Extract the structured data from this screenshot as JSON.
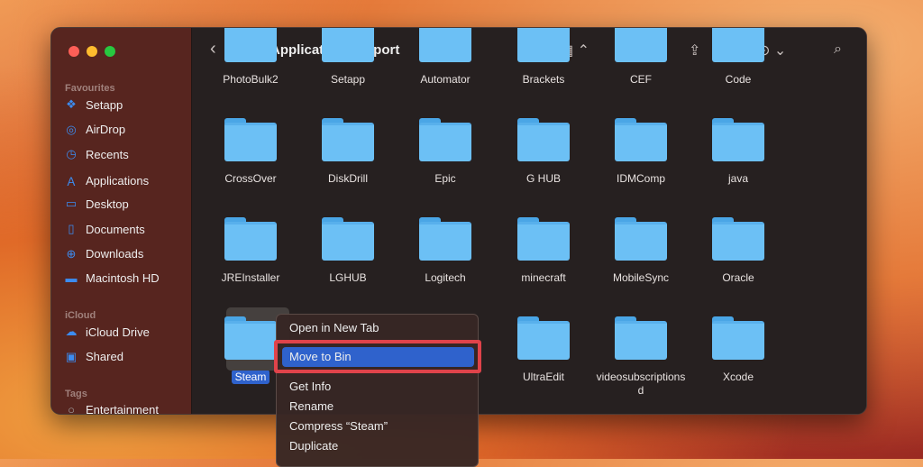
{
  "window": {
    "title": "Application Support"
  },
  "sidebar": {
    "sections": [
      {
        "title": "Favourites",
        "items": [
          {
            "label": "Setapp",
            "icon": "setapp-icon"
          },
          {
            "label": "AirDrop",
            "icon": "airdrop-icon"
          },
          {
            "label": "Recents",
            "icon": "clock-icon"
          },
          {
            "label": "Applications",
            "icon": "applications-icon"
          },
          {
            "label": "Desktop",
            "icon": "desktop-icon"
          },
          {
            "label": "Documents",
            "icon": "document-icon"
          },
          {
            "label": "Downloads",
            "icon": "download-icon"
          },
          {
            "label": "Macintosh HD",
            "icon": "disk-icon"
          }
        ]
      },
      {
        "title": "iCloud",
        "items": [
          {
            "label": "iCloud Drive",
            "icon": "cloud-icon"
          },
          {
            "label": "Shared",
            "icon": "shared-folder-icon"
          }
        ]
      },
      {
        "title": "Tags",
        "items": [
          {
            "label": "Entertainment",
            "icon": "tag-circle-icon"
          }
        ]
      }
    ]
  },
  "grid": {
    "row0": [
      "PhotoBulk2",
      "Setapp",
      "Automator",
      "Brackets",
      "CEF",
      "Code"
    ],
    "row1": [
      "CrossOver",
      "DiskDrill",
      "Epic",
      "G HUB",
      "IDMComp",
      "java"
    ],
    "row2": [
      "JREInstaller",
      "LGHUB",
      "Logitech",
      "minecraft",
      "MobileSync",
      "Oracle"
    ],
    "row3": [
      "Steam",
      "",
      "",
      "UltraEdit",
      "videosubscriptionsd",
      "Xcode"
    ]
  },
  "context_menu": [
    "Open in New Tab",
    "Move to Bin",
    "Get Info",
    "Rename",
    "Compress “Steam”",
    "Duplicate"
  ],
  "colors": {
    "accent": "#2f62cc",
    "highlight_box": "#e0434a",
    "folder": "#6cc0f5"
  }
}
